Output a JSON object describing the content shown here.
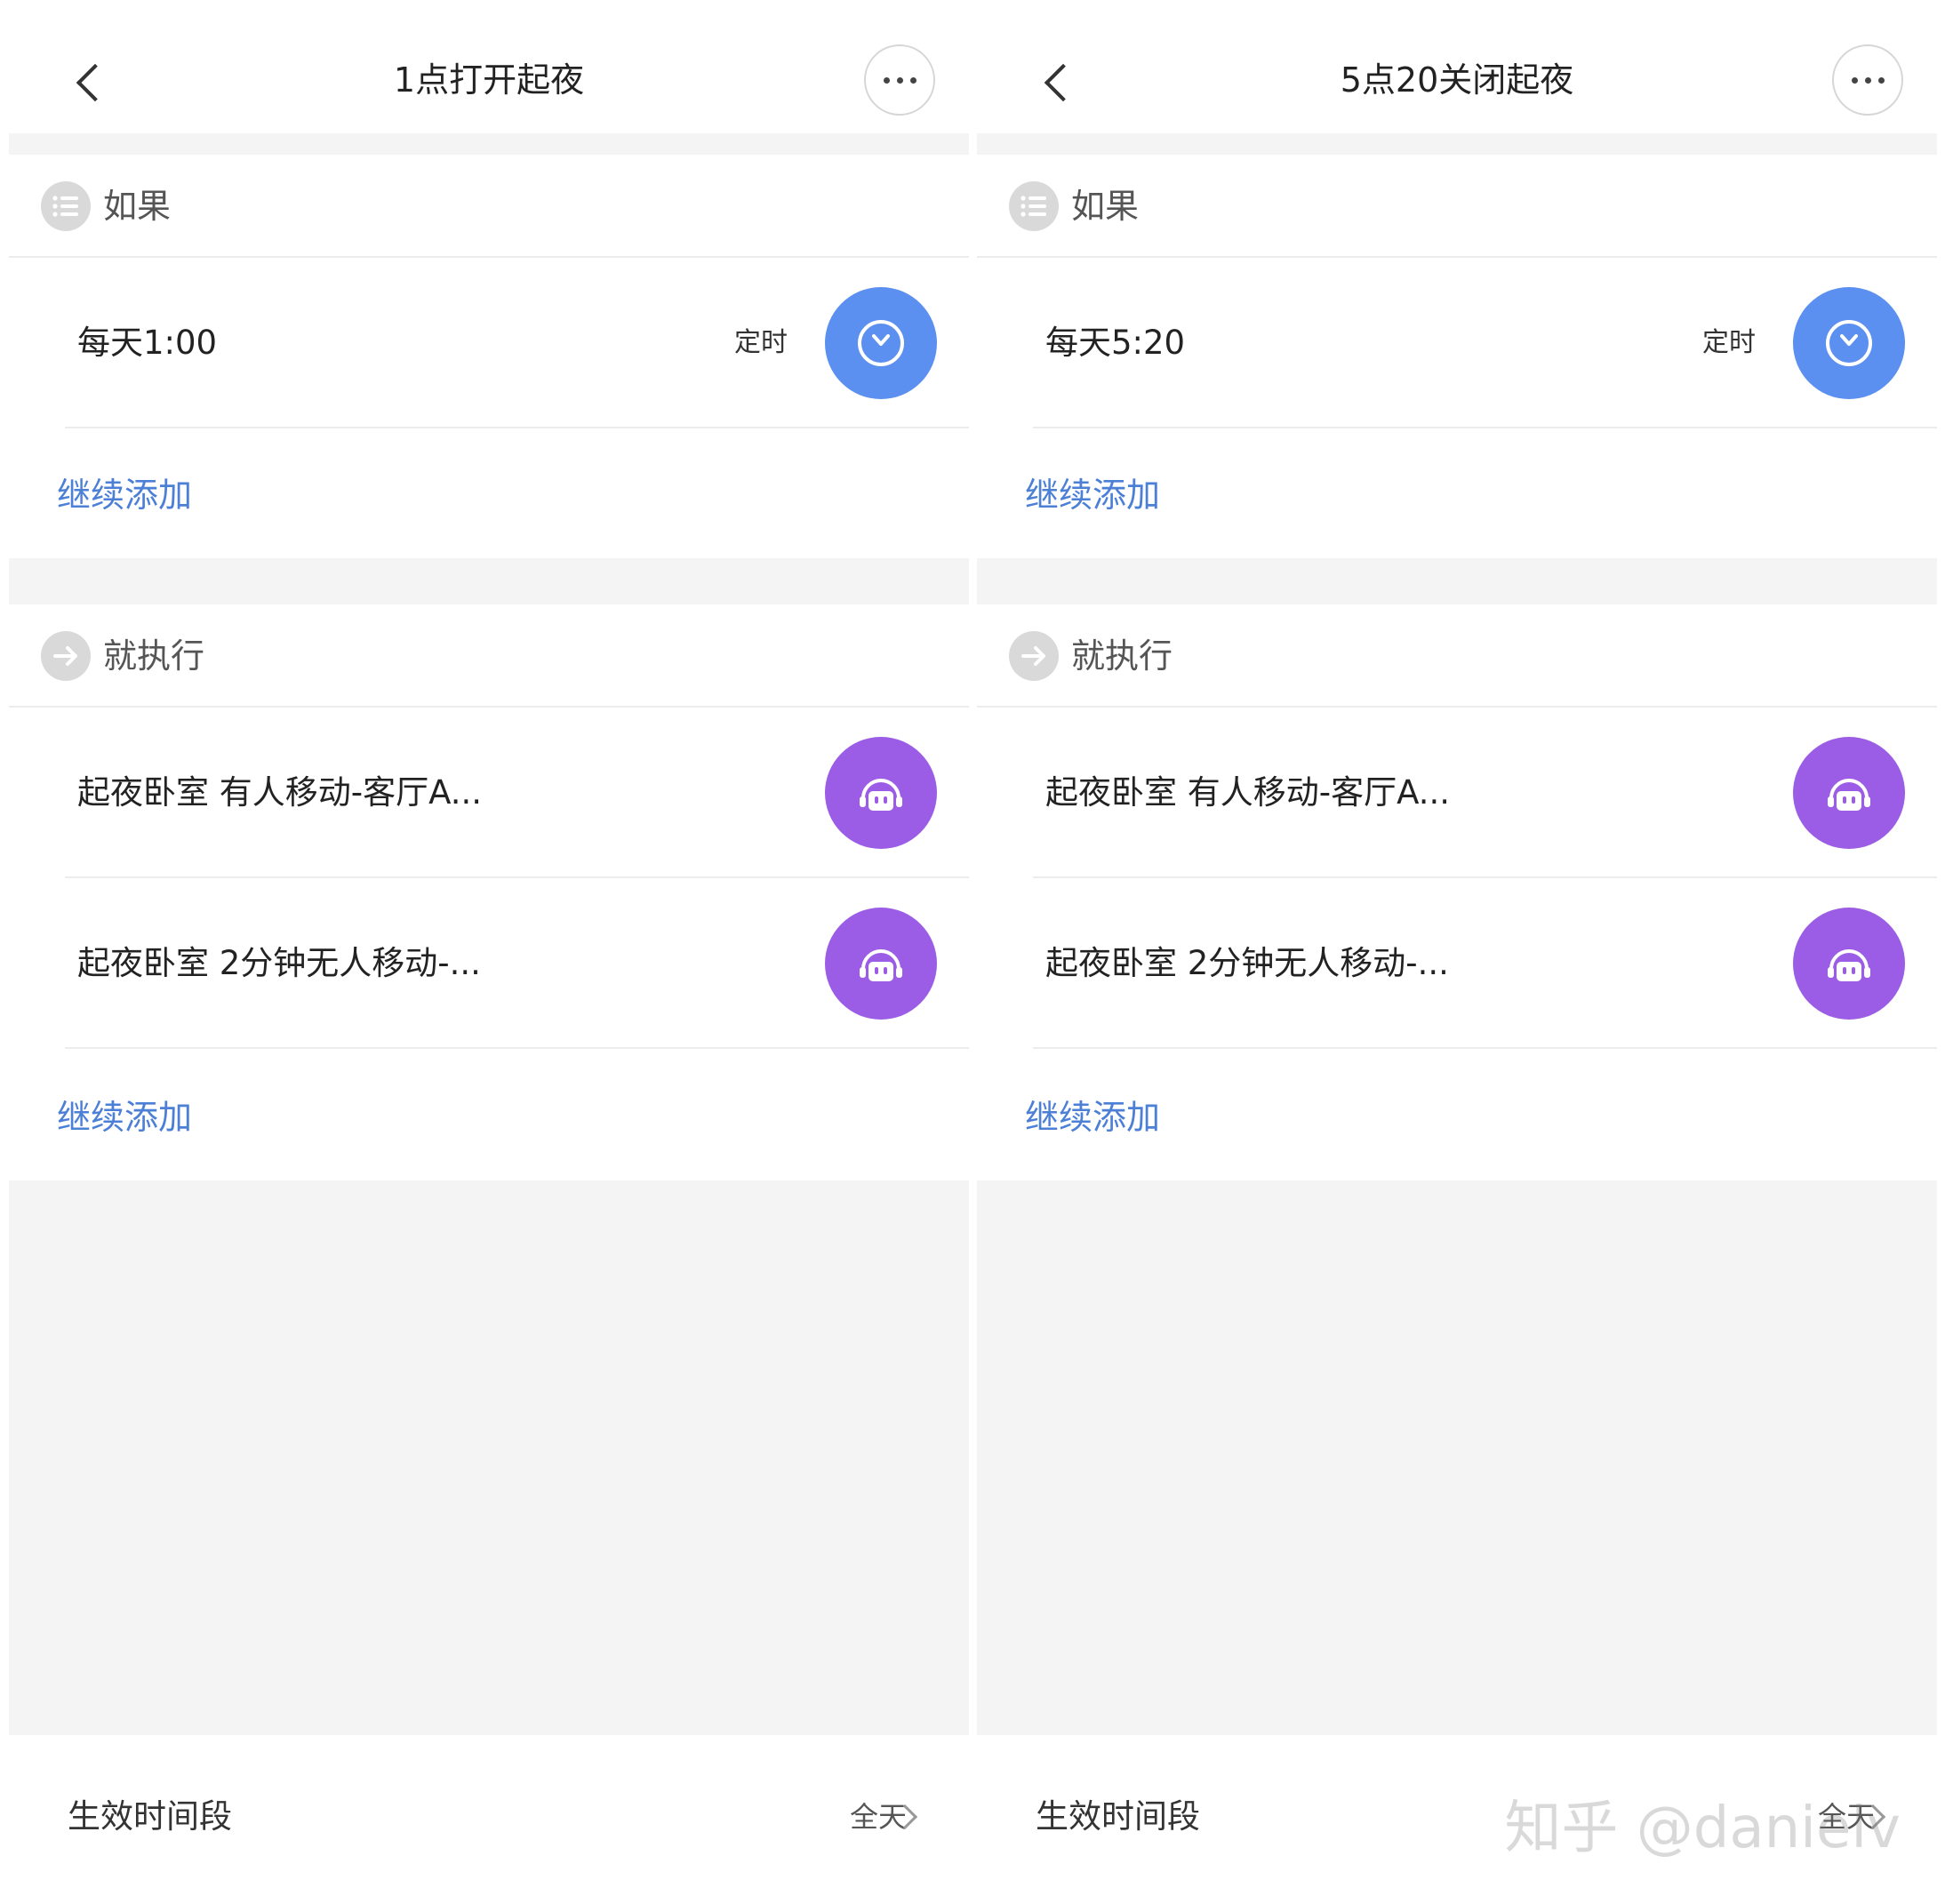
{
  "panels": [
    {
      "title": "1点打开起夜",
      "if_section": {
        "label": "如果"
      },
      "conditions": [
        {
          "text": "每天1:00",
          "tag": "定时"
        }
      ],
      "if_add_label": "继续添加",
      "then_section": {
        "label": "就执行"
      },
      "actions": [
        {
          "text": "起夜卧室 有人移动-客厅A..."
        },
        {
          "text": "起夜卧室 2分钟无人移动-..."
        }
      ],
      "then_add_label": "继续添加",
      "footer": {
        "label": "生效时间段",
        "value": "全天"
      }
    },
    {
      "title": "5点20关闭起夜",
      "if_section": {
        "label": "如果"
      },
      "conditions": [
        {
          "text": "每天5:20",
          "tag": "定时"
        }
      ],
      "if_add_label": "继续添加",
      "then_section": {
        "label": "就执行"
      },
      "actions": [
        {
          "text": "起夜卧室 有人移动-客厅A..."
        },
        {
          "text": "起夜卧室 2分钟无人移动-..."
        }
      ],
      "then_add_label": "继续添加",
      "footer": {
        "label": "生效时间段",
        "value": "全天"
      }
    }
  ],
  "watermark": "知乎 @danielv",
  "colors": {
    "link": "#4c7fd6",
    "timer_icon": "#5b8ff0",
    "scene_icon": "#9b5ce6",
    "background": "#f4f4f4"
  }
}
